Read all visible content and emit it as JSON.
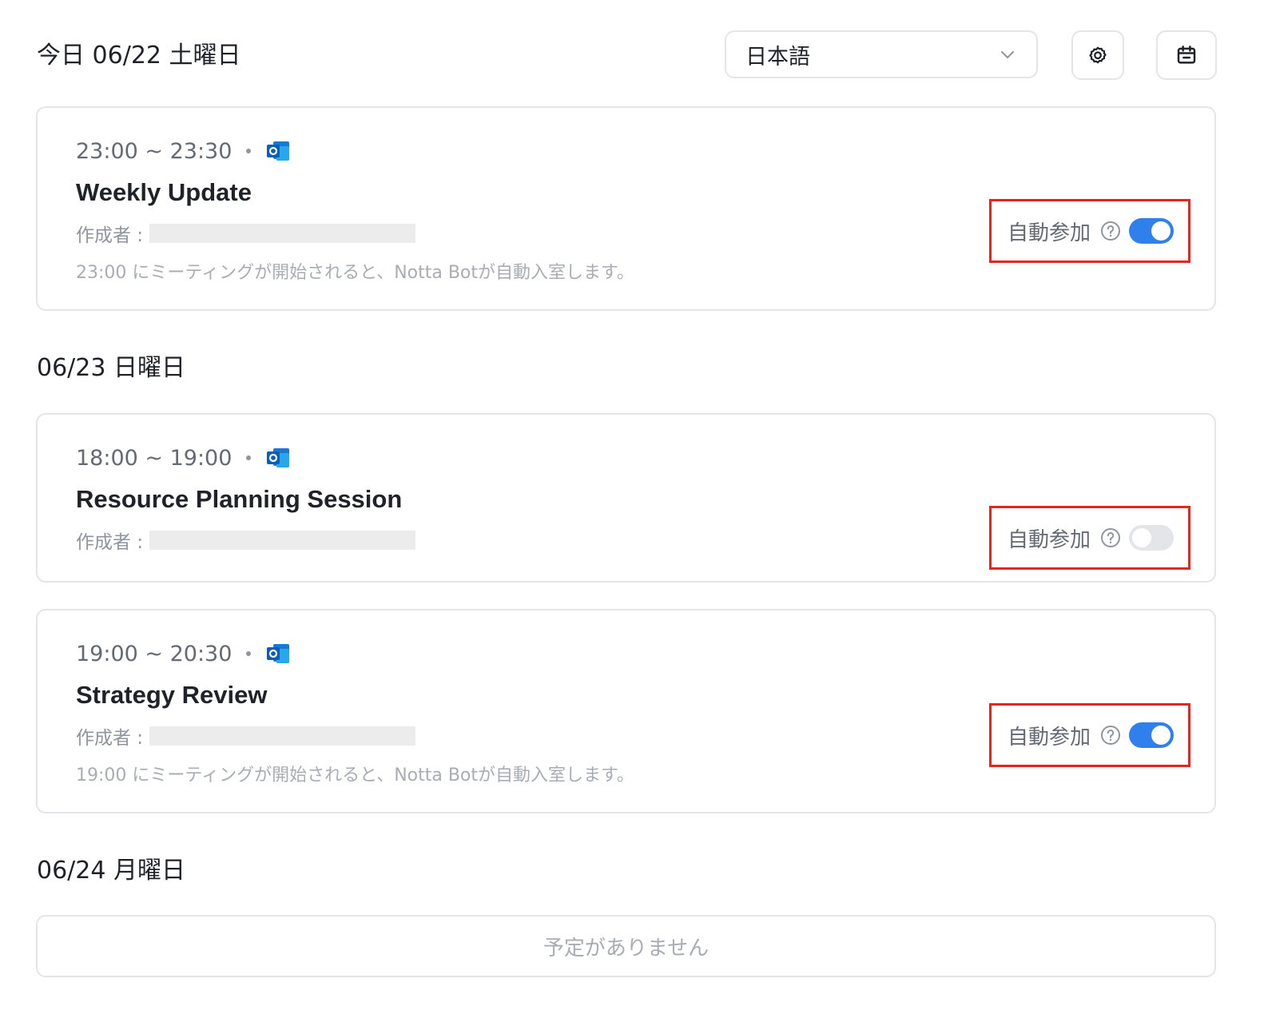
{
  "header": {
    "title": "今日 06/22 土曜日",
    "language_select": {
      "value": "日本語"
    },
    "settings_icon": "gear-icon",
    "calendar_icon": "calendar-icon"
  },
  "days": [
    {
      "heading": "今日 06/22 土曜日",
      "events": [
        {
          "time": "23:00 ~ 23:30",
          "source_icon": "outlook-icon",
          "title": "Weekly Update",
          "creator_label": "作成者 :",
          "note": "23:00 にミーティングが開始されると、Notta Botが自動入室します。",
          "auto_join_label": "自動参加",
          "auto_join": true
        }
      ]
    },
    {
      "heading": "06/23 日曜日",
      "events": [
        {
          "time": "18:00 ~ 19:00",
          "source_icon": "outlook-icon",
          "title": "Resource Planning Session",
          "creator_label": "作成者 :",
          "auto_join_label": "自動参加",
          "auto_join": false
        },
        {
          "time": "19:00 ~ 20:30",
          "source_icon": "outlook-icon",
          "title": "Strategy Review",
          "creator_label": "作成者 :",
          "note": "19:00 にミーティングが開始されると、Notta Botが自動入室します。",
          "auto_join_label": "自動参加",
          "auto_join": true
        }
      ]
    },
    {
      "heading": "06/24 月曜日",
      "empty_text": "予定がありません"
    }
  ],
  "colors": {
    "toggle_on": "#2f80ed",
    "toggle_off": "#e3e5e8",
    "highlight_border": "#e8241f"
  }
}
